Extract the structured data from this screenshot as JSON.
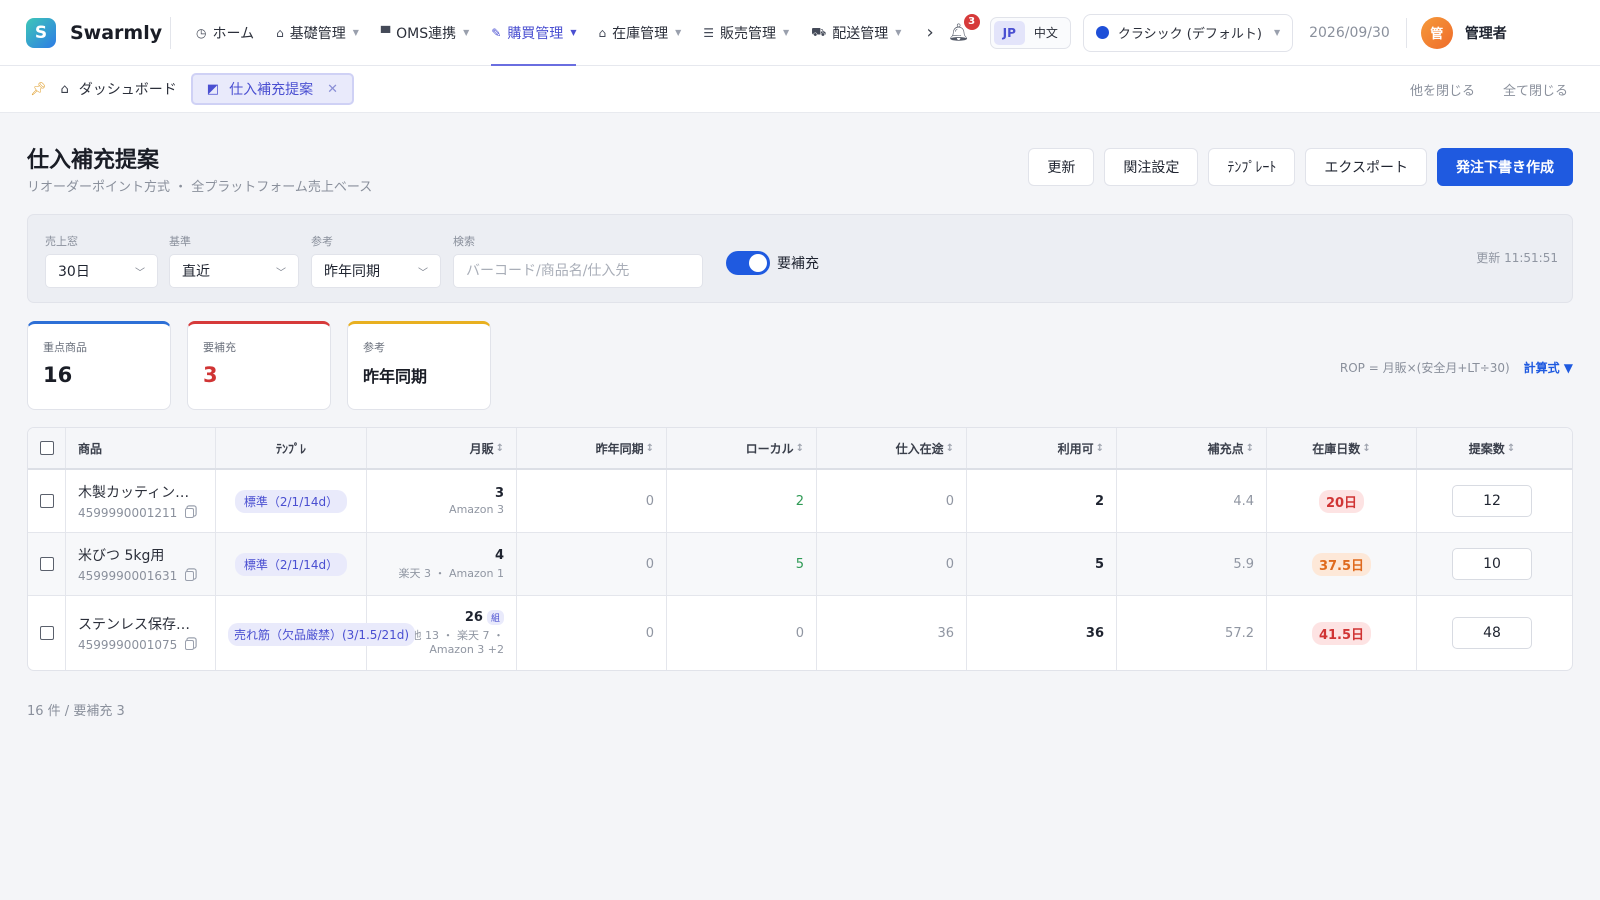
{
  "app": {
    "name": "Swarmly",
    "logo_letter": "S"
  },
  "nav": {
    "items": [
      {
        "icon": "dashboard-icon",
        "glyph": "◷",
        "label": "ホーム",
        "caret": false,
        "active": false
      },
      {
        "icon": "bag-icon",
        "glyph": "⌂",
        "label": "基礎管理",
        "caret": true,
        "active": false
      },
      {
        "icon": "database-icon",
        "glyph": "▀",
        "label": "OMS連携",
        "caret": true,
        "active": false
      },
      {
        "icon": "pen-icon",
        "glyph": "✎",
        "label": "購買管理",
        "caret": true,
        "active": true
      },
      {
        "icon": "warehouse-icon",
        "glyph": "⌂",
        "label": "在庫管理",
        "caret": true,
        "active": false
      },
      {
        "icon": "document-icon",
        "glyph": "☰",
        "label": "販売管理",
        "caret": true,
        "active": false
      },
      {
        "icon": "truck-icon",
        "glyph": "⛟",
        "label": "配送管理",
        "caret": true,
        "active": false
      }
    ],
    "more": "›",
    "notifications": "3",
    "lang": {
      "jp": "JP",
      "cn": "中文"
    },
    "theme": "クラシック (デフォルト)",
    "date": "2026/09/30",
    "avatar": "管",
    "user": "管理者"
  },
  "tabs": {
    "dashboard": "ダッシュボード",
    "current": "仕入補充提案",
    "close_others": "他を閉じる",
    "close_all": "全て閉じる"
  },
  "page": {
    "title": "仕入補充提案",
    "subtitle": "リオーダーポイント方式 ・ 全プラットフォーム売上ベース",
    "buttons": {
      "refresh": "更新",
      "related": "関注設定",
      "template": "ﾃﾝﾌﾟﾚｰﾄ",
      "export": "エクスポート",
      "create": "発注下書き作成"
    }
  },
  "filters": {
    "window_label": "売上窓",
    "window_value": "30日",
    "basis_label": "基準",
    "basis_value": "直近",
    "ref_label": "参考",
    "ref_value": "昨年同期",
    "search_label": "検索",
    "search_placeholder": "バーコード/商品名/仕入先",
    "toggle_label": "要補充",
    "updated": "更新 11:51:51"
  },
  "cards": {
    "key_label": "重点商品",
    "key_value": "16",
    "need_label": "要補充",
    "need_value": "3",
    "ref_label": "参考",
    "ref_value": "昨年同期"
  },
  "formula": {
    "text": "ROP = 月販×(安全月+LT÷30)",
    "link": "計算式 ▼"
  },
  "table": {
    "headers": [
      "商品",
      "ﾃﾝﾌﾟﾚ",
      "月販",
      "昨年同期",
      "ローカル",
      "仕入在途",
      "利用可",
      "補充点",
      "在庫日数",
      "提案数"
    ],
    "rows": [
      {
        "name": "木製カッティン…",
        "code": "4599990001211",
        "tag": "標準（2/1/14d）",
        "sales": "3",
        "sales_detail": "Amazon 3",
        "last_year": "0",
        "local": "2",
        "transit": "0",
        "available": "2",
        "rop": "4.4",
        "days": "20日",
        "days_color": "red",
        "qty": "12"
      },
      {
        "name": "米びつ 5kg用",
        "code": "4599990001631",
        "tag": "標準（2/1/14d）",
        "sales": "4",
        "sales_detail": "楽天 3 ・ Amazon 1",
        "last_year": "0",
        "local": "5",
        "transit": "0",
        "available": "5",
        "rop": "5.9",
        "days": "37.5日",
        "days_color": "orange",
        "qty": "10"
      },
      {
        "name": "ステンレス保存…",
        "code": "4599990001075",
        "tag": "売れ筋（欠品厳禁）(3/1.5/21d)",
        "sales": "26",
        "set_badge": "組",
        "sales_detail": "他 13 ・ 楽天 7 ・",
        "sales_detail2": "Amazon 3 +2",
        "last_year": "0",
        "local": "0",
        "transit": "36",
        "available": "36",
        "rop": "57.2",
        "days": "41.5日",
        "days_color": "red",
        "qty": "48"
      }
    ]
  },
  "footer": "16 件 / 要補充 3",
  "colors": {
    "accent": "#1f5ae0",
    "nav_active": "#4a4fd1",
    "danger": "#d03434",
    "warning": "#df6a1e",
    "card_blue": "#2d6fd6",
    "card_red": "#d63a3a",
    "card_yellow": "#e8b020"
  }
}
